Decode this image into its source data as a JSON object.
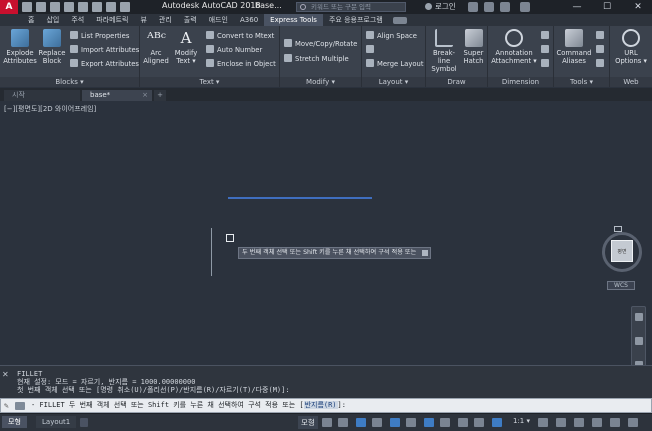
{
  "titlebar": {
    "app_logo": "A",
    "title": "Autodesk AutoCAD 2018",
    "file": "base...",
    "search_placeholder": "키워드 또는 구문 입력",
    "login": "로그인",
    "minimize": "—",
    "maximize": "☐",
    "close": "✕"
  },
  "tabs": [
    "홈",
    "삽입",
    "주석",
    "파라메트릭",
    "뷰",
    "관리",
    "출력",
    "애드인",
    "A360",
    "Express Tools",
    "주요 응용프로그램"
  ],
  "active_tab": "Express Tools",
  "ribbon": {
    "blocks": {
      "title": "Blocks ▾",
      "explode": "Explode\nAttributes",
      "replace": "Replace\nBlock",
      "list_props": "List Properties",
      "import_attr": "Import Attributes",
      "export_attr": "Export Attributes"
    },
    "text": {
      "title": "Text ▾",
      "arc": "Arc\nAligned",
      "modify": "Modify\nText ▾",
      "convert": "Convert to Mtext",
      "auto_number": "Auto Number",
      "enclose": "Enclose in Object"
    },
    "modify": {
      "title": "Modify ▾",
      "move_copy": "Move/Copy/Rotate",
      "stretch": "Stretch Multiple"
    },
    "layout": {
      "title": "Layout ▾",
      "align_space": "Align Space",
      "merge": "Merge Layout"
    },
    "draw": {
      "title": "Draw",
      "breakline": "Break-line\nSymbol",
      "super_hatch": "Super\nHatch"
    },
    "dimension": {
      "title": "Dimension",
      "annotation": "Annotation\nAttachment ▾"
    },
    "tools": {
      "title": "Tools ▾",
      "command_aliases": "Command\nAliases"
    },
    "web": {
      "title": "Web",
      "url_options": "URL\nOptions ▾"
    }
  },
  "filetabs": {
    "start": "시작",
    "file": "base*",
    "close": "×",
    "plus": "+"
  },
  "canvas": {
    "view_label": "[−][평면도][2D 와이어프레임]",
    "tooltip": "두 번째 객체 선택 또는 Shift 키를 누른 채 선택하여 구석 적용 또는",
    "viewcube_label": "평면",
    "wcs": "WCS"
  },
  "command": {
    "history": [
      "FILLET",
      "현재 설정: 모드 = 자르기, 반지름 = 1000.00000000",
      "첫 번째 객체 선택 또는 [명령 취소(U)/폴리선(P)/반지름(R)/자르기(T)/다중(M)]:"
    ],
    "prompt_prefix": "- FILLET 두 번째 객체 선택 또는 Shift 키를 누른 채 선택하여 구석 적용 또는 [",
    "prompt_option": "반지름(R)",
    "prompt_suffix": "]:",
    "close_icon": "✕"
  },
  "statusbar": {
    "model_tab": "모형",
    "layout_tab": "Layout1",
    "model_label": "모형",
    "scale": "1:1 ▾"
  }
}
